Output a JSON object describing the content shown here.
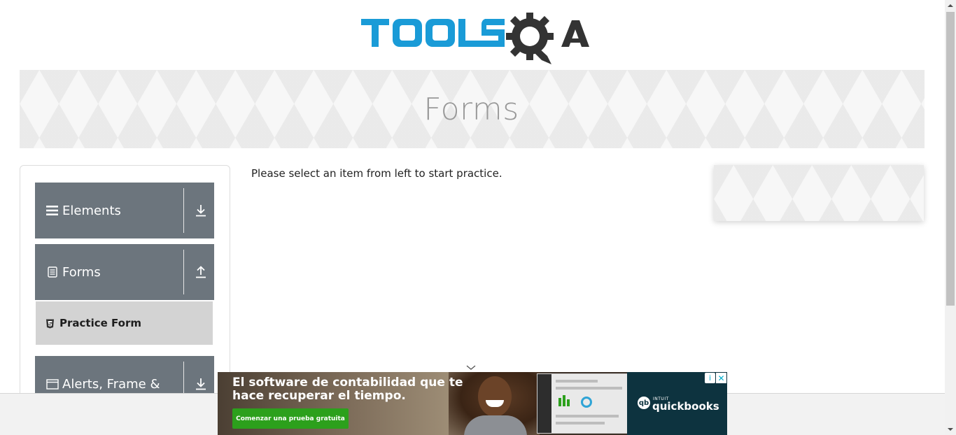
{
  "header": {
    "logo_alt": "TOOLSQA",
    "brand_colors": {
      "tools": "#1a9bd7",
      "qa": "#333333"
    }
  },
  "banner": {
    "title": "Forms"
  },
  "sidebar": {
    "groups": [
      {
        "title": "Elements",
        "icon": "list-icon",
        "arrow": "download-arrow-icon"
      },
      {
        "title": "Forms",
        "icon": "document-icon",
        "arrow": "upload-arrow-icon",
        "items": [
          {
            "label": "Practice Form",
            "icon": "html5-icon"
          }
        ]
      },
      {
        "title": "Alerts, Frame &",
        "icon": "window-icon",
        "arrow": "download-arrow-icon"
      }
    ]
  },
  "main": {
    "message": "Please select an item from left to start practice."
  },
  "ad": {
    "headline": "El software de contabilidad que te hace recuperar el tiempo.",
    "cta": "Comenzar una prueba gratuita",
    "brand_small": "INTUIT",
    "brand": "quickbooks",
    "adchoices_label": "i",
    "close_label": "✕",
    "colors": {
      "cta": "#2ca01c",
      "brand_bg": "#0d333f"
    }
  },
  "colors": {
    "group_header": "#6c757d",
    "active_item": "#d3d3d3",
    "banner_title": "#999999"
  }
}
